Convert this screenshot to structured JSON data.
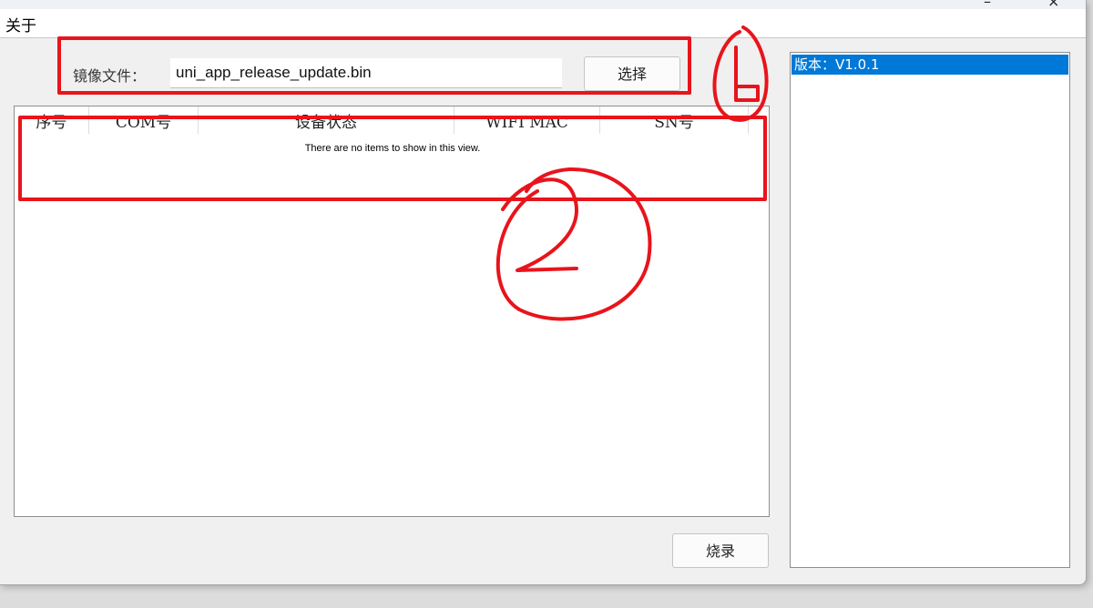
{
  "menu": {
    "about_label": "关于"
  },
  "image_file": {
    "label": "镜像文件：",
    "value": "uni_app_release_update.bin",
    "select_label": "选择"
  },
  "device_list": {
    "columns": [
      "序号",
      "COM号",
      "设备状态",
      "WIFI MAC",
      "SN号"
    ],
    "empty_text": "There are no items to show in this view."
  },
  "burn_label": "烧录",
  "version_list": {
    "items": [
      "版本：V1.0.1"
    ]
  },
  "annotation_color": "#e8141c"
}
